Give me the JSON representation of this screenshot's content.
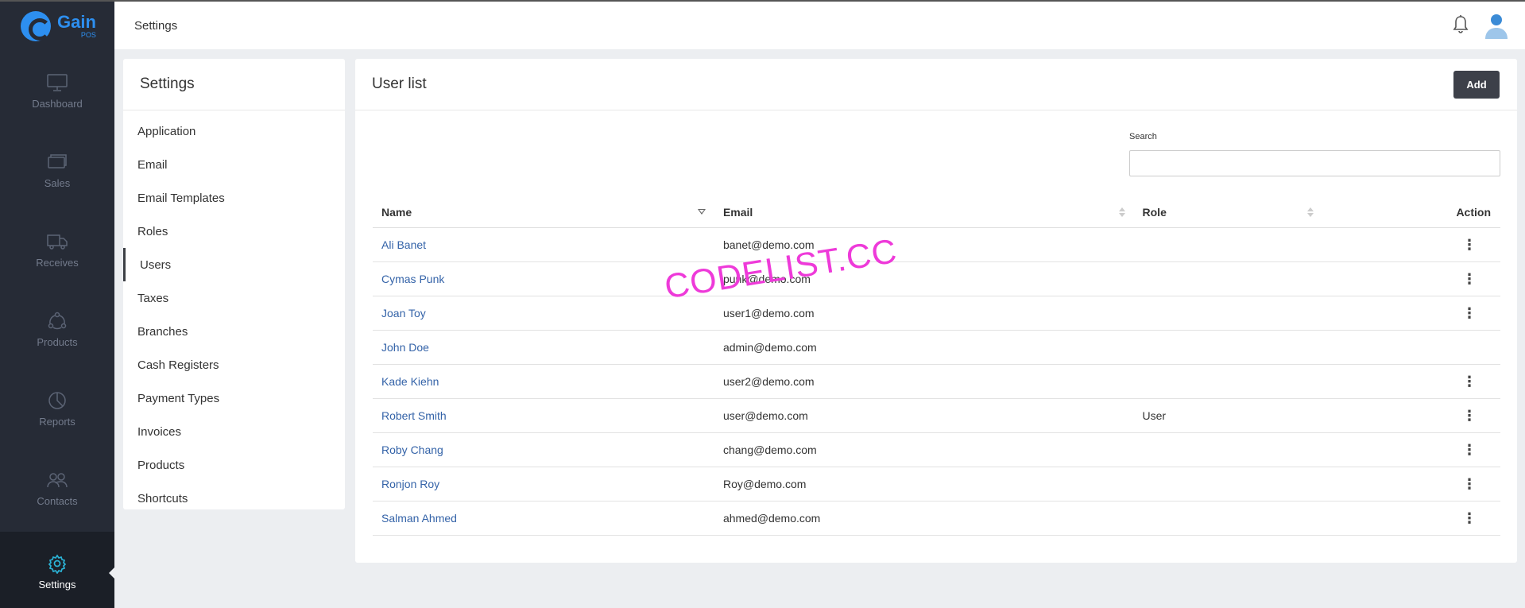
{
  "app": {
    "name": "Gain",
    "sub": "POS"
  },
  "sidebar": {
    "items": [
      {
        "label": "Dashboard",
        "icon": "monitor-icon"
      },
      {
        "label": "Sales",
        "icon": "cards-icon"
      },
      {
        "label": "Receives",
        "icon": "truck-icon"
      },
      {
        "label": "Products",
        "icon": "cycle-icon"
      },
      {
        "label": "Reports",
        "icon": "pie-chart-icon"
      },
      {
        "label": "Contacts",
        "icon": "users-icon"
      },
      {
        "label": "Settings",
        "icon": "gear-icon",
        "active": true
      }
    ]
  },
  "topbar": {
    "title": "Settings"
  },
  "settings": {
    "title": "Settings",
    "items": [
      "Application",
      "Email",
      "Email Templates",
      "Roles",
      "Users",
      "Taxes",
      "Branches",
      "Cash Registers",
      "Payment Types",
      "Invoices",
      "Products",
      "Shortcuts"
    ],
    "active": "Users"
  },
  "userlist": {
    "title": "User list",
    "add_label": "Add",
    "search_label": "Search",
    "search_value": "",
    "columns": {
      "name": "Name",
      "email": "Email",
      "role": "Role",
      "action": "Action"
    },
    "rows": [
      {
        "name": "Ali Banet",
        "email": "banet@demo.com",
        "role": "",
        "action": "⋮"
      },
      {
        "name": "Cymas Punk",
        "email": "punk@demo.com",
        "role": "",
        "action": "⋮"
      },
      {
        "name": "Joan Toy",
        "email": "user1@demo.com",
        "role": "",
        "action": "⋮"
      },
      {
        "name": "John Doe",
        "email": "admin@demo.com",
        "role": "",
        "action": ""
      },
      {
        "name": "Kade Kiehn",
        "email": "user2@demo.com",
        "role": "",
        "action": "⋮"
      },
      {
        "name": "Robert Smith",
        "email": "user@demo.com",
        "role": "User",
        "action": "⋮"
      },
      {
        "name": "Roby Chang",
        "email": "chang@demo.com",
        "role": "",
        "action": "⋮"
      },
      {
        "name": "Ronjon Roy",
        "email": "Roy@demo.com",
        "role": "",
        "action": "⋮"
      },
      {
        "name": "Salman Ahmed",
        "email": "ahmed@demo.com",
        "role": "",
        "action": "⋮"
      }
    ]
  },
  "watermark": "CODELIST.CC",
  "colors": {
    "sidebar": "#262b36",
    "accent": "#2d8ff0",
    "link": "#3463a8",
    "button": "#3d4049"
  }
}
